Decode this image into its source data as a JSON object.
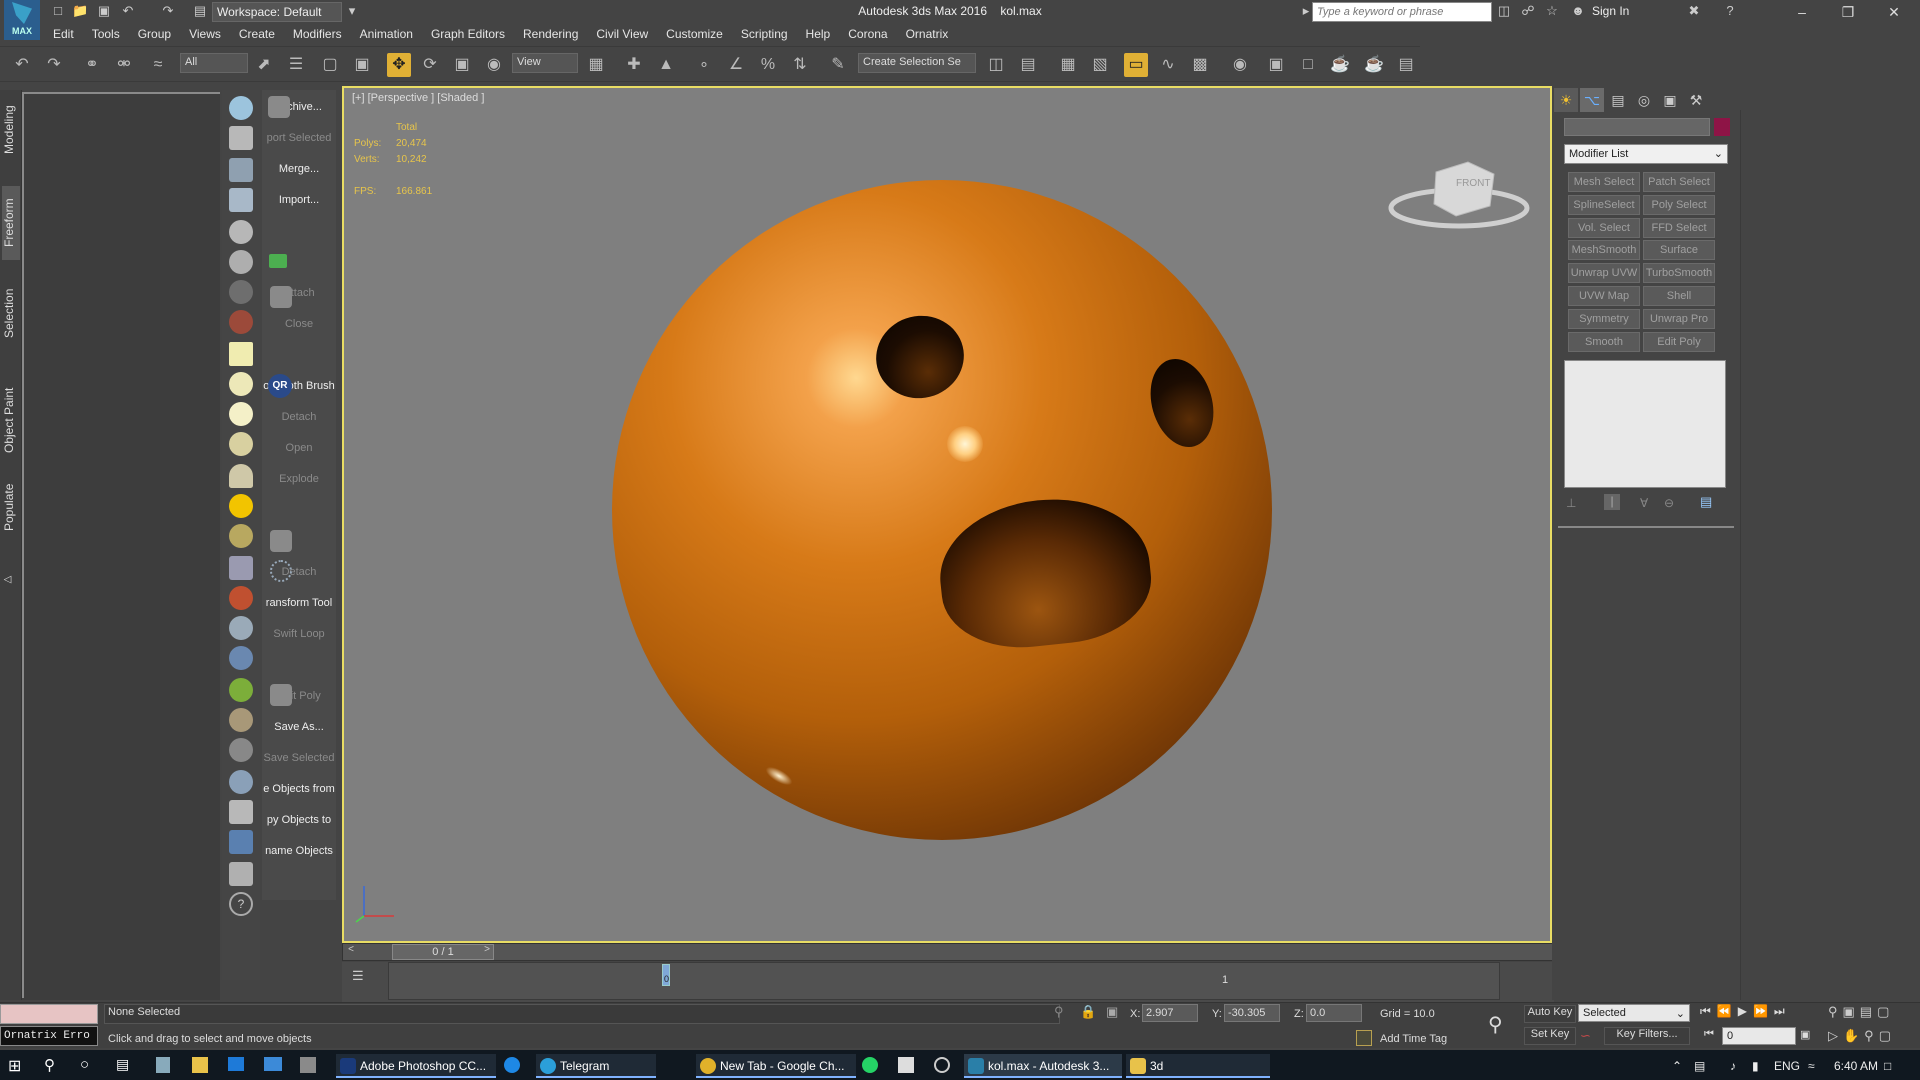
{
  "titlebar": {
    "workspace": "Workspace: Default",
    "app_title": "Autodesk 3ds Max 2016",
    "file": "kol.max",
    "search_placeholder": "Type a keyword or phrase",
    "sign_in": "Sign In"
  },
  "menu": [
    "Edit",
    "Tools",
    "Group",
    "Views",
    "Create",
    "Modifiers",
    "Animation",
    "Graph Editors",
    "Rendering",
    "Civil View",
    "Customize",
    "Scripting",
    "Help",
    "Corona",
    "Ornatrix"
  ],
  "toolbar": {
    "filter": "All",
    "ref_coord": "View",
    "selection_set": "Create Selection Se"
  },
  "ribbon_tabs": [
    "Modeling",
    "Freeform",
    "Selection",
    "Object Paint",
    "Populate"
  ],
  "quad_labels": [
    {
      "text": "Archive...",
      "dim": false
    },
    {
      "text": "port Selected",
      "dim": true
    },
    {
      "text": "Merge...",
      "dim": false
    },
    {
      "text": "Import...",
      "dim": false
    },
    {
      "text": "",
      "dim": false
    },
    {
      "text": "",
      "dim": false
    },
    {
      "text": "Attach",
      "dim": true
    },
    {
      "text": "Close",
      "dim": true
    },
    {
      "text": "",
      "dim": false
    },
    {
      "text": "olyCloth Brush",
      "dim": false
    },
    {
      "text": "Detach",
      "dim": true
    },
    {
      "text": "Open",
      "dim": true
    },
    {
      "text": "Explode",
      "dim": true
    },
    {
      "text": "",
      "dim": false
    },
    {
      "text": "",
      "dim": false
    },
    {
      "text": "Detach",
      "dim": true
    },
    {
      "text": "ransform Tool",
      "dim": false
    },
    {
      "text": "Swift Loop",
      "dim": true
    },
    {
      "text": "",
      "dim": false
    },
    {
      "text": "Edit Poly",
      "dim": true
    },
    {
      "text": "Save As...",
      "dim": false
    },
    {
      "text": "Save Selected",
      "dim": true
    },
    {
      "text": "e Objects from",
      "dim": false
    },
    {
      "text": "py Objects to",
      "dim": false
    },
    {
      "text": "name Objects",
      "dim": false
    }
  ],
  "viewport": {
    "label": "[+] [Perspective ] [Shaded ]",
    "stats_header": "Total",
    "polys_label": "Polys:",
    "polys": "20,474",
    "verts_label": "Verts:",
    "verts": "10,242",
    "fps_label": "FPS:",
    "fps": "166.861",
    "navcube_label": "FRONT"
  },
  "timeline": {
    "slider": "0 / 1",
    "tick_0": "0",
    "tick_1": "1"
  },
  "command_panel": {
    "modifier_list": "Modifier List",
    "buttons": [
      "Mesh Select",
      "Patch Select",
      "SplineSelect",
      "Poly Select",
      "Vol. Select",
      "FFD Select",
      "MeshSmooth",
      "Surface Select",
      "Unwrap UVW",
      "TurboSmooth",
      "UVW Map",
      "Shell",
      "Symmetry",
      "Unwrap Pro",
      "Smooth",
      "Edit Poly"
    ],
    "color_swatch": "#8e1446"
  },
  "status": {
    "script_error": "Ornatrix Erro",
    "selection": "None Selected",
    "prompt": "Click and drag to select and move objects",
    "x_label": "X:",
    "x": "2.907",
    "y_label": "Y:",
    "y": "-30.305",
    "z_label": "Z:",
    "z": "0.0",
    "grid": "Grid = 10.0",
    "add_time_tag": "Add Time Tag",
    "auto_key": "Auto Key",
    "set_key": "Set Key",
    "selected": "Selected",
    "key_filters": "Key Filters...",
    "frame": "0"
  },
  "taskbar": {
    "items": [
      {
        "label": "Adobe Photoshop CC...",
        "color": "#1a3a7a"
      },
      {
        "label": "Telegram",
        "color": "#2b9fd9"
      },
      {
        "label": "New Tab - Google Ch...",
        "color": "#e0b12a"
      },
      {
        "label": "kol.max - Autodesk 3...",
        "color": "#2a7fa8"
      },
      {
        "label": "3d",
        "color": "#e8c24a"
      }
    ],
    "lang": "ENG",
    "time": "6:40 AM"
  }
}
